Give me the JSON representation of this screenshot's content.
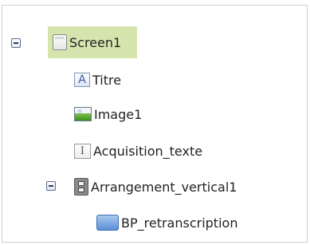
{
  "tree": {
    "nodes": [
      {
        "label": "Screen1",
        "icon": "screen-icon",
        "expanded": true,
        "selected": true
      },
      {
        "label": "Titre",
        "icon": "label-icon",
        "icon_glyph": "A"
      },
      {
        "label": "Image1",
        "icon": "image-icon"
      },
      {
        "label": "Acquisition_texte",
        "icon": "textbox-icon",
        "icon_glyph": "I"
      },
      {
        "label": "Arrangement_vertical1",
        "icon": "vertical-arrangement-icon",
        "expanded": true
      },
      {
        "label": "BP_retranscription",
        "icon": "button-icon"
      }
    ],
    "selection_color": "#d6e5ae"
  }
}
